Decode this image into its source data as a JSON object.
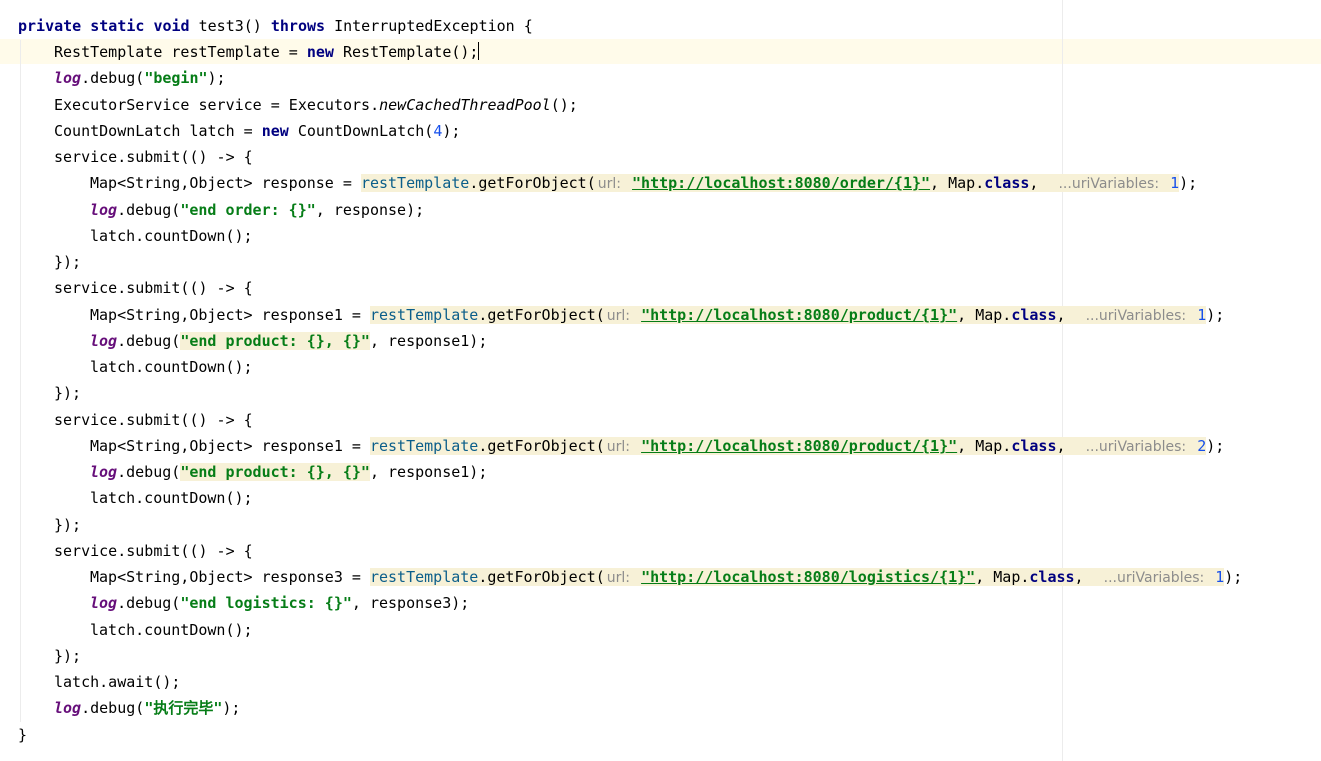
{
  "editor": {
    "method_sig": {
      "kw1": "private",
      "kw2": "static",
      "kw3": "void",
      "name": "test3()",
      "kw4": "throws",
      "exc": "InterruptedException {"
    },
    "line_rt": {
      "decl": "RestTemplate restTemplate = ",
      "new": "new",
      "ctor": " RestTemplate();"
    },
    "line_log_begin": {
      "log": "log",
      "call": ".debug(",
      "str": "\"begin\"",
      "end": ");"
    },
    "line_exec": {
      "decl": "ExecutorService service = Executors.",
      "method": "newCachedThreadPool",
      "end": "();"
    },
    "line_latch": {
      "decl": "CountDownLatch latch = ",
      "new": "new",
      "ctor": " CountDownLatch(",
      "num": "4",
      "end": ");"
    },
    "submit_open": "service.submit(() -> {",
    "submit_close": "});",
    "blocks": [
      {
        "resp_decl": "Map<String,Object> response = ",
        "rt": "restTemplate",
        "get": ".getForObject(",
        "url_hint": "url:",
        "url": "\"http://localhost:8080/order/{1}\"",
        "map": ", Map.",
        "class_kw": "class",
        "comma": ",",
        "vars_hint": "...uriVariables:",
        "num": "1",
        "end": ");",
        "log": "log",
        "log_call": ".debug(",
        "log_str": "\"end order: {}\"",
        "log_end": ", response);",
        "countdown": "latch.countDown();"
      },
      {
        "resp_decl": "Map<String,Object> response1 = ",
        "rt": "restTemplate",
        "get": ".getForObject(",
        "url_hint": "url:",
        "url": "\"http://localhost:8080/product/{1}\"",
        "map": ", Map.",
        "class_kw": "class",
        "comma": ",",
        "vars_hint": "...uriVariables:",
        "num": "1",
        "end": ");",
        "log": "log",
        "log_call": ".debug(",
        "log_str": "\"end product: {}, {}\"",
        "log_end": ", response1);",
        "countdown": "latch.countDown();"
      },
      {
        "resp_decl": "Map<String,Object> response1 = ",
        "rt": "restTemplate",
        "get": ".getForObject(",
        "url_hint": "url:",
        "url": "\"http://localhost:8080/product/{1}\"",
        "map": ", Map.",
        "class_kw": "class",
        "comma": ",",
        "vars_hint": "...uriVariables:",
        "num": "2",
        "end": ");",
        "log": "log",
        "log_call": ".debug(",
        "log_str": "\"end product: {}, {}\"",
        "log_end": ", response1);",
        "countdown": "latch.countDown();"
      },
      {
        "resp_decl": "Map<String,Object> response3 = ",
        "rt": "restTemplate",
        "get": ".getForObject(",
        "url_hint": "url:",
        "url": "\"http://localhost:8080/logistics/{1}\"",
        "map": ", Map.",
        "class_kw": "class",
        "comma": ",",
        "vars_hint": "...uriVariables:",
        "num": "1",
        "end": ");",
        "log": "log",
        "log_call": ".debug(",
        "log_str": "\"end logistics: {}\"",
        "log_end": ", response3);",
        "countdown": "latch.countDown();"
      }
    ],
    "await": "latch.await();",
    "final_log": {
      "log": "log",
      "call": ".debug(",
      "str": "\"执行完毕\"",
      "end": ");"
    },
    "closing_brace": "}"
  },
  "colors": {
    "keyword": "#000080",
    "string": "#067d17",
    "number": "#1750eb",
    "hint": "#8c8c8c",
    "highlight": "#f7f1d7",
    "current_line": "#fffbea"
  }
}
